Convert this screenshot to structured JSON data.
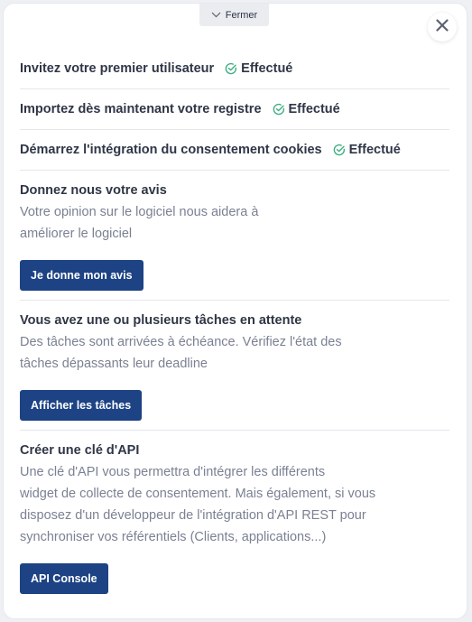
{
  "header": {
    "collapse_label": "Fermer"
  },
  "completed_steps": [
    {
      "label": "Invitez votre premier utilisateur",
      "status": "Effectué"
    },
    {
      "label": "Importez dès maintenant votre registre",
      "status": "Effectué"
    },
    {
      "label": "Démarrez l'intégration du consentement cookies",
      "status": "Effectué"
    }
  ],
  "sections": [
    {
      "title": "Donnez nous votre avis",
      "lines": [
        "Votre opinion sur le logiciel nous aidera à",
        "améliorer le logiciel"
      ],
      "button": "Je donne mon avis"
    },
    {
      "title": "Vous avez une ou plusieurs tâches en attente",
      "lines": [
        "Des tâches sont arrivées à échéance. Vérifiez l'état des",
        "tâches dépassants leur deadline"
      ],
      "button": "Afficher les tâches"
    },
    {
      "title": "Créer une clé d'API",
      "lines": [
        "Une clé d'API vous permettra d'intégrer les différents",
        "widget de collecte de consentement. Mais également, si vous",
        "disposez d'un développeur de l'intégration d'API REST pour",
        "synchroniser vos référentiels (Clients, applications...)"
      ],
      "button": "API Console"
    }
  ],
  "colors": {
    "primary_button": "#1d4384",
    "success_check": "#3fae82",
    "title_text": "#2f3646",
    "body_text": "#7b8193"
  },
  "icons": {
    "collapse": "chevron-down-icon",
    "close": "close-icon",
    "done": "check-circle-icon"
  }
}
